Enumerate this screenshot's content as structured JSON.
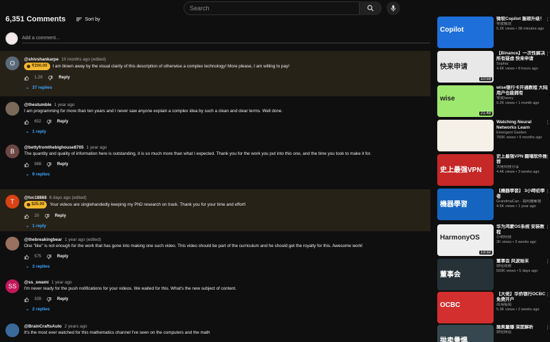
{
  "search": {
    "placeholder": "Search"
  },
  "comments_header": {
    "count": "6,351 Comments",
    "sort": "Sort by"
  },
  "add_comment": {
    "placeholder": "Add a comment..."
  },
  "comments": [
    {
      "author": "@shivshankarpe",
      "time": "10 months ago (edited)",
      "chip": "₹200.00",
      "text": "I am blown away by the visual clarity of this description of otherwise a complex technology! More please, I am willing to pay!",
      "likes": "1.2K",
      "replies": "37 replies",
      "avatar_letter": "O",
      "avatar_color": "#5b6b7a",
      "highlight": true
    },
    {
      "author": "@thestumble",
      "time": "1 year ago",
      "chip": "",
      "text": "I am programming for more than ten years and I never saw anyone explain a complex idea by such a clean and clear terms. Well done.",
      "likes": "652",
      "replies": "1 reply",
      "avatar_letter": "",
      "avatar_color": "#7a6a5a",
      "highlight": false
    },
    {
      "author": "@bettyfromthebighouse8705",
      "time": "1 year ago",
      "chip": "",
      "text": "The quantity and quality of information here is outstanding, it is so much more than what I expected. Thank you for the work you put into this one, and the time you took to make it for.",
      "likes": "988",
      "replies": "9 replies",
      "avatar_letter": "B",
      "avatar_color": "#6d4646",
      "highlight": false
    },
    {
      "author": "@tvc18868",
      "time": "6 days ago (edited)",
      "chip": "$25.00",
      "text": "Your videos are singlehandedly keeping my PhD research on track. Thank you for your time and effort!",
      "likes": "20",
      "replies": "1 reply",
      "avatar_letter": "T",
      "avatar_color": "#d84315",
      "highlight": true
    },
    {
      "author": "@thebreakingbear",
      "time": "1 year ago (edited)",
      "chip": "",
      "text": "One \"like\" is not enough for the work that has gone into making one such video. This video should be part of the curriculum and he should get the royalty for this. Awesome work!",
      "likes": "575",
      "replies": "3 replies",
      "avatar_letter": "",
      "avatar_color": "#9a7060",
      "highlight": false
    },
    {
      "author": "@ss_swami",
      "time": "1 year ago",
      "chip": "",
      "text": "I'm never ready for the push notifications for your videos. We waited for this. What's the new subject of content.",
      "likes": "339",
      "replies": "2 replies",
      "avatar_letter": "SS",
      "avatar_color": "#c2185b",
      "highlight": false
    },
    {
      "author": "@BrainCraftsAuto",
      "time": "2 years ago",
      "chip": "",
      "text": "It's the most ever watched for this mathematics channel I've seen on the computers and the math",
      "likes": "",
      "replies": "",
      "avatar_letter": "",
      "avatar_color": "#3a6a9a",
      "highlight": false
    }
  ],
  "reply_label": "Reply",
  "recommendations": [
    {
      "title": "微软Copilot 重磅升级！",
      "channel": "零度解说",
      "meta": "5.2K views • 38 minutes ago",
      "duration": "",
      "thumb_color": "#1e6fd9",
      "thumb_text": "Copilot"
    },
    {
      "title": "【Binance】一次性解决所有疑虑 快来申请",
      "channel": "Sophia",
      "meta": "4.6K views • 8 hours ago",
      "duration": "10:59",
      "thumb_color": "#e8e8e8",
      "thumb_text": "快来申请"
    },
    {
      "title": "wise银行卡开通教程 大陆用户也能拥有",
      "channel": "零度henry",
      "meta": "9.2K views • 1 month ago",
      "duration": "21:48",
      "thumb_color": "#9fe870",
      "thumb_text": "wise"
    },
    {
      "title": "Watching Neural Networks Learn",
      "channel": "Emergent Garden",
      "meta": "765K views • 9 months ago",
      "duration": "",
      "thumb_color": "#f5f0e8",
      "thumb_text": ""
    },
    {
      "title": "史上最强VPN 翻墙软件推荐",
      "channel": "大佬科技分享",
      "meta": "4.4K views • 3 weeks ago",
      "duration": "",
      "thumb_color": "#c62828",
      "thumb_text": "史上最强VPN"
    },
    {
      "title": "【機器學習】 3小時初學者",
      "channel": "GrandmaCan - 我阿嬤都會",
      "meta": "4.6K views • 1 year ago",
      "duration": "",
      "thumb_color": "#1565c0",
      "thumb_text": "機器學習"
    },
    {
      "title": "华为鸿蒙OS系统 安装教程",
      "channel": "小明科技",
      "meta": "3K views • 3 weeks ago",
      "duration": "13:32",
      "thumb_color": "#eeeeee",
      "thumb_text": "HarmonyOS"
    },
    {
      "title": "董事会 风波始末",
      "channel": "财经观察",
      "meta": "593K views • 5 days ago",
      "duration": "",
      "thumb_color": "#263238",
      "thumb_text": "董事会"
    },
    {
      "title": "【大佬】华侨银行OCBC 免费开户",
      "channel": "出海指南",
      "meta": "5.3K views • 2 weeks ago",
      "duration": "",
      "thumb_color": "#d32f2f",
      "thumb_text": "OCBC"
    },
    {
      "title": "拋卖量爆 深度解析",
      "channel": "财经频道",
      "meta": "",
      "duration": "",
      "thumb_color": "#37474f",
      "thumb_text": "拋卖量爆"
    }
  ]
}
